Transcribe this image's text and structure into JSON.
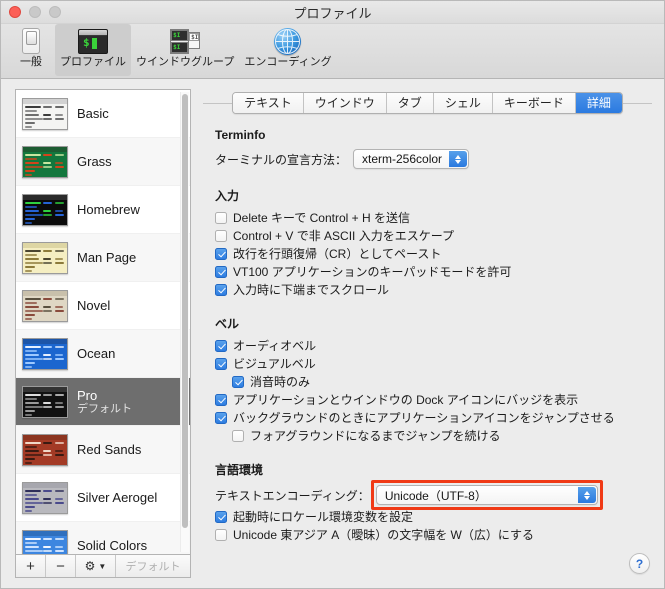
{
  "window": {
    "title": "プロファイル",
    "controls": {
      "close": "close-button",
      "minimize": "minimize-button",
      "maximize": "maximize-button"
    }
  },
  "toolbar": {
    "items": [
      {
        "label": "一般",
        "icon": "general-toggle-icon",
        "selected": false
      },
      {
        "label": "プロファイル",
        "icon": "terminal-icon",
        "selected": true
      },
      {
        "label": "ウインドウグループ",
        "icon": "window-group-icon",
        "selected": false
      },
      {
        "label": "エンコーディング",
        "icon": "globe-icon",
        "selected": false
      }
    ]
  },
  "sidebar": {
    "profiles": [
      {
        "name": "Basic",
        "sub": "",
        "selected": false,
        "bg": "#f4f4f2",
        "fg": "#3b3b3b",
        "accent": "#6d6d6d",
        "title_bar": "#d2d2d2"
      },
      {
        "name": "Grass",
        "sub": "",
        "selected": false,
        "bg": "#13773d",
        "fg": "#c8e6a0",
        "accent": "#d2441b",
        "title_bar": "#1d5c32"
      },
      {
        "name": "Homebrew",
        "sub": "",
        "selected": false,
        "bg": "#0b0b0b",
        "fg": "#2fd13f",
        "accent": "#2563d6",
        "title_bar": "#2b2b2b"
      },
      {
        "name": "Man Page",
        "sub": "",
        "selected": false,
        "bg": "#f5eec2",
        "fg": "#4a4530",
        "accent": "#8c7a3a",
        "title_bar": "#ded6a4"
      },
      {
        "name": "Novel",
        "sub": "",
        "selected": false,
        "bg": "#dfd7c4",
        "fg": "#59503f",
        "accent": "#8a4b3c",
        "title_bar": "#c9c0ab"
      },
      {
        "name": "Ocean",
        "sub": "",
        "selected": false,
        "bg": "#1b66cf",
        "fg": "#e6f0ff",
        "accent": "#9ec9ff",
        "title_bar": "#1c55a8"
      },
      {
        "name": "Pro",
        "sub": "デフォルト",
        "selected": true,
        "bg": "#111111",
        "fg": "#dcdcdc",
        "accent": "#9a9a9a",
        "title_bar": "#333333"
      },
      {
        "name": "Red Sands",
        "sub": "",
        "selected": false,
        "bg": "#a33a25",
        "fg": "#f0d8c8",
        "accent": "#3a1a12",
        "title_bar": "#8c3520"
      },
      {
        "name": "Silver Aerogel",
        "sub": "",
        "selected": false,
        "bg": "#b9b9be",
        "fg": "#2f2f5a",
        "accent": "#4a4a8c",
        "title_bar": "#a7a7ae"
      },
      {
        "name": "Solid Colors",
        "sub": "",
        "selected": false,
        "bg": "#3d86e0",
        "fg": "#f2f7ff",
        "accent": "#cfe3ff",
        "title_bar": "#2f6fbd"
      }
    ],
    "toolbar": {
      "add": "+",
      "remove": "−",
      "gear": "gear-icon",
      "chevron": "chevron-down-icon",
      "default_label": "デフォルト"
    }
  },
  "pane": {
    "tabs": [
      {
        "label": "テキスト",
        "active": false
      },
      {
        "label": "ウインドウ",
        "active": false
      },
      {
        "label": "タブ",
        "active": false
      },
      {
        "label": "シェル",
        "active": false
      },
      {
        "label": "キーボード",
        "active": false
      },
      {
        "label": "詳細",
        "active": true
      }
    ],
    "terminfo": {
      "title": "Terminfo",
      "declare_label": "ターミナルの宣言方法：",
      "declare_value": "xterm-256color"
    },
    "input": {
      "title": "入力",
      "options": [
        {
          "label": "Delete キーで Control + H を送信",
          "checked": false,
          "indent": false
        },
        {
          "label": "Control + V で非 ASCII 入力をエスケープ",
          "checked": false,
          "indent": false
        },
        {
          "label": "改行を行頭復帰（CR）としてペースト",
          "checked": true,
          "indent": false
        },
        {
          "label": "VT100 アプリケーションのキーパッドモードを許可",
          "checked": true,
          "indent": false
        },
        {
          "label": "入力時に下端までスクロール",
          "checked": true,
          "indent": false
        }
      ]
    },
    "bell": {
      "title": "ベル",
      "options": [
        {
          "label": "オーディオベル",
          "checked": true,
          "indent": false
        },
        {
          "label": "ビジュアルベル",
          "checked": true,
          "indent": false
        },
        {
          "label": "消音時のみ",
          "checked": true,
          "indent": true
        },
        {
          "label": "アプリケーションとウインドウの Dock アイコンにバッジを表示",
          "checked": true,
          "indent": false
        },
        {
          "label": "バックグラウンドのときにアプリケーションアイコンをジャンプさせる",
          "checked": true,
          "indent": false
        },
        {
          "label": "フォアグラウンドになるまでジャンプを続ける",
          "checked": false,
          "indent": true
        }
      ]
    },
    "locale": {
      "title": "言語環境",
      "encoding_label": "テキストエンコーディング：",
      "encoding_value": "Unicode（UTF-8）",
      "highlight_color": "#f03a16",
      "options": [
        {
          "label": "起動時にロケール環境変数を設定",
          "checked": true,
          "indent": false
        },
        {
          "label": "Unicode 東アジア A（曖昧）の文字幅を W（広）にする",
          "checked": false,
          "indent": false
        }
      ]
    },
    "help_label": "?"
  }
}
